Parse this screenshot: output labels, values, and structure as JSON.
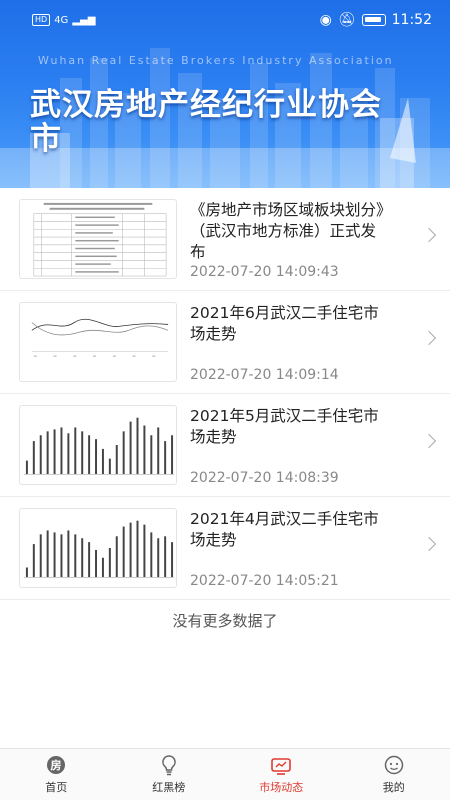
{
  "status_bar": {
    "carrier_chip": "HD",
    "signal_text": "4G",
    "time": "11:52"
  },
  "header": {
    "english_banner": "Wuhan  Real Estate Brokers Industry Association",
    "title": "武汉房地产经纪行业协会市"
  },
  "articles": [
    {
      "title": "《房地产市场区域板块划分》（武汉市地方标准）正式发布",
      "date": "2022-07-20 14:09:43",
      "thumb": "table"
    },
    {
      "title": "2021年6月武汉二手住宅市场走势",
      "date": "2022-07-20 14:09:14",
      "thumb": "line"
    },
    {
      "title": "2021年5月武汉二手住宅市场走势",
      "date": "2022-07-20 14:08:39",
      "thumb": "bars"
    },
    {
      "title": "2021年4月武汉二手住宅市场走势",
      "date": "2022-07-20 14:05:21",
      "thumb": "bars"
    }
  ],
  "list_footer": "没有更多数据了",
  "nav": {
    "items": [
      {
        "label": "首页",
        "icon": "home-icon",
        "active": false
      },
      {
        "label": "红黑榜",
        "icon": "bulb-icon",
        "active": false
      },
      {
        "label": "市场动态",
        "icon": "tv-icon",
        "active": true
      },
      {
        "label": "我的",
        "icon": "profile-icon",
        "active": false
      }
    ],
    "active_color": "#e03a2f"
  },
  "colors": {
    "header_blue": "#2a7df0"
  }
}
